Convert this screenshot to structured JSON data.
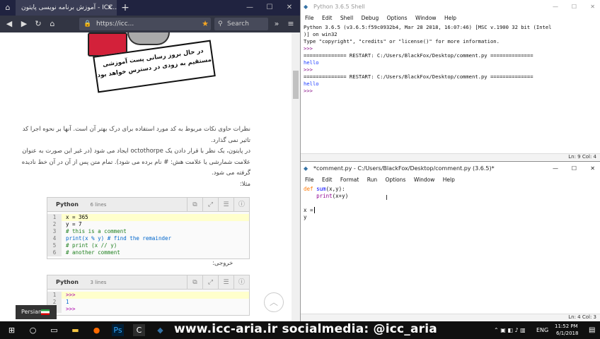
{
  "browser": {
    "tab_title": "آموزش برنامه نویسی پایتون - ICC...",
    "tab_close": "×",
    "new_tab": "+",
    "url": "https://icc...",
    "search_placeholder": "Search",
    "window_min": "—",
    "window_max": "☐",
    "window_close": "✕",
    "banner_lines": [
      "در حال بروز رسانی پست آموزشی",
      "مستقیم به زودی در دسترس خواهد بود"
    ],
    "paragraphs": [
      "نظرات حاوی نکات مربوط به کد مورد استفاده برای درک بهتر آن است. آنها بر نحوه اجرا کد تاثیر نمی گذارد.",
      "در پایتون، یک نظر با قرار دادن یک octothorpe ایجاد می شود (در غیر این صورت به عنوان علامت شمارشی یا علامت هش: # نام برده می شود). تمام متن پس از آن در آن خط نادیده گرفته می شود.",
      "مثلا:"
    ],
    "output_label": "خروجی:",
    "language_button": "Persian",
    "code_block_1": {
      "lang": "Python",
      "lines_label": "6 lines",
      "lines": [
        {
          "n": "1",
          "text": "x = 365"
        },
        {
          "n": "2",
          "text": "y = 7"
        },
        {
          "n": "3",
          "text": "# this is a comment"
        },
        {
          "n": "4",
          "text": "print(x % y) # find the remainder"
        },
        {
          "n": "5",
          "text": "# print (x // y)"
        },
        {
          "n": "6",
          "text": "# another comment"
        }
      ]
    },
    "code_block_2": {
      "lang": "Python",
      "lines_label": "3 lines",
      "lines": [
        {
          "n": "1",
          "text": ">>>"
        },
        {
          "n": "2",
          "text": "1"
        },
        {
          "n": "3",
          "text": ">>>"
        }
      ]
    }
  },
  "shell": {
    "title": "Python 3.6.5 Shell",
    "menu": [
      "File",
      "Edit",
      "Shell",
      "Debug",
      "Options",
      "Window",
      "Help"
    ],
    "lines": [
      "Python 3.6.5 (v3.6.5:f59c0932b4, Mar 28 2018, 16:07:46) [MSC v.1900 32 bit (Intel",
      ")] on win32",
      "Type \"copyright\", \"credits\" or \"license()\" for more information.",
      ">>> ",
      "============== RESTART: C:/Users/BlackFox/Desktop/comment.py ==============",
      "hello",
      ">>> ",
      "============== RESTART: C:/Users/BlackFox/Desktop/comment.py ==============",
      "hello",
      ">>> "
    ],
    "status": "Ln: 9  Col: 4"
  },
  "editor": {
    "title": "*comment.py - C:/Users/BlackFox/Desktop/comment.py (3.6.5)*",
    "menu": [
      "File",
      "Edit",
      "Format",
      "Run",
      "Options",
      "Window",
      "Help"
    ],
    "code": {
      "kw_def": "def",
      "fn_name": "sum",
      "def_rest": "(x,y):",
      "print_kw": "print",
      "print_rest": "(x+y)",
      "line_x": "x =",
      "line_y": "y"
    },
    "status": "Ln: 4  Col: 3"
  },
  "taskbar": {
    "watermark": "www.icc-aria.ir   socialmedia: @icc_aria",
    "lang": "ENG",
    "time": "11:52 PM",
    "date": "6/1/2018"
  }
}
